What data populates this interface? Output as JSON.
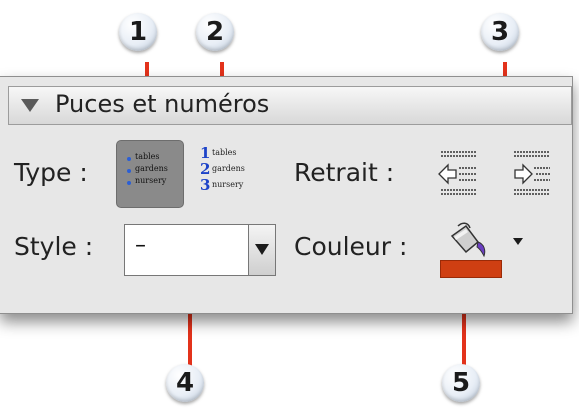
{
  "callouts": [
    "1",
    "2",
    "3",
    "4",
    "5"
  ],
  "panel": {
    "title": "Puces et numéros",
    "type_label": "Type :",
    "retrait_label": "Retrait :",
    "style_label": "Style :",
    "couleur_label": "Couleur :",
    "style_value": "–"
  },
  "bullet_list": [
    "tables",
    "gardens",
    "nursery"
  ],
  "numbered_list": {
    "numbers": [
      "1",
      "2",
      "3"
    ],
    "items": [
      "tables",
      "gardens",
      "nursery"
    ]
  },
  "colors": {
    "callout_line": "#e3321b",
    "fill_color": "#cf3f12",
    "accent": "#2b5fd6"
  },
  "icons": [
    "disclosure-triangle-icon",
    "indent-decrease-icon",
    "indent-increase-icon",
    "paint-bucket-icon",
    "dropdown-arrow-icon"
  ]
}
